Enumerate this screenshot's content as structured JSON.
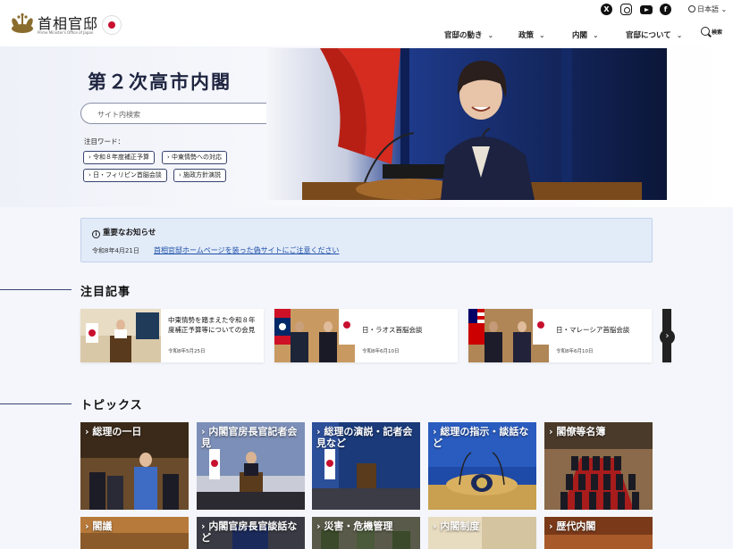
{
  "header": {
    "logo_title": "首相官邸",
    "logo_subtitle": "Prime Minister's Office of Japan",
    "social_icons": [
      "x-icon",
      "instagram-icon",
      "youtube-icon",
      "facebook-icon"
    ],
    "language": "日本語",
    "nav": [
      {
        "label": "官邸の動き",
        "icon": "chevron-down-icon"
      },
      {
        "label": "政策",
        "icon": "chevron-down-icon"
      },
      {
        "label": "内閣",
        "icon": "chevron-down-icon"
      },
      {
        "label": "官邸について",
        "icon": "chevron-down-icon"
      }
    ],
    "search_label": "検索"
  },
  "hero": {
    "title": "第２次高市内閣",
    "search_placeholder": "サイト内検索",
    "keywords_label": "注目ワード：",
    "keywords": [
      "令和８年度補正予算",
      "中東情勢への対応",
      "日・フィリピン首脳会談",
      "施政方針演説"
    ]
  },
  "notice": {
    "title": "重要なお知らせ",
    "date": "令和8年4月21日",
    "link": "首相官邸ホームページを装った偽サイトにご注意ください"
  },
  "featured": {
    "heading": "注目記事",
    "cards": [
      {
        "title": "中東情勢を踏まえた令和８年度補正予算等についての会見",
        "date": "令和8年5月25日"
      },
      {
        "title": "日・ラオス首脳会談",
        "date": "令和8年6月10日"
      },
      {
        "title": "日・マレーシア首脳会談",
        "date": "令和8年6月10日"
      }
    ]
  },
  "topics": {
    "heading": "トピックス",
    "items": [
      "総理の一日",
      "内閣官房長官記者会見",
      "総理の演説・記者会見など",
      "総理の指示・談話など",
      "閣僚等名簿",
      "閣議",
      "内閣官房長官談話など",
      "災害・危機管理",
      "内閣制度",
      "歴代内閣"
    ]
  },
  "colors": {
    "navy": "#1f2540",
    "notice_bg": "#e2ebf8",
    "link": "#1c4fa8",
    "flag_red": "#c8102e"
  }
}
